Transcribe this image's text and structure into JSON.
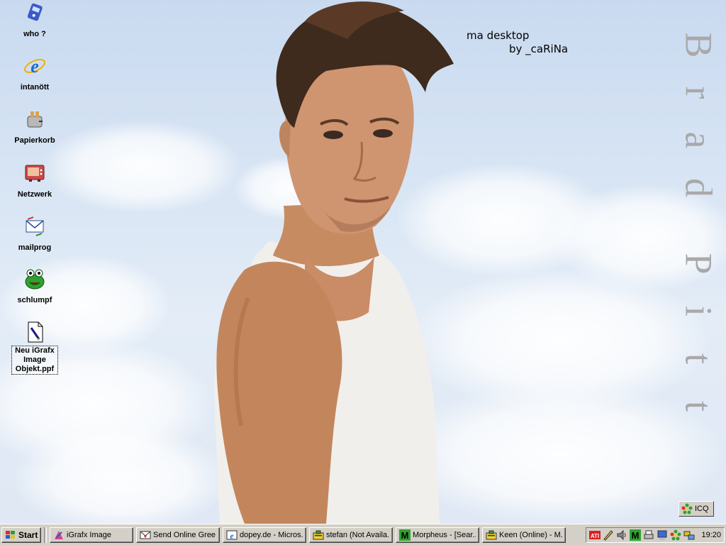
{
  "desktop": {
    "caption_line1": "ma desktop",
    "caption_line2": "by _caRiNa",
    "vertical_name": [
      "B",
      "r",
      "a",
      "d",
      "P",
      "i",
      "t",
      "t"
    ],
    "icons": [
      {
        "label": "who ?",
        "icon": "blue-device-icon"
      },
      {
        "label": "intanött",
        "icon": "internet-explorer-icon"
      },
      {
        "label": "Papierkorb",
        "icon": "toaster-recycle-bin-icon"
      },
      {
        "label": "Netzwerk",
        "icon": "network-tv-icon"
      },
      {
        "label": "mailprog",
        "icon": "mail-program-icon"
      },
      {
        "label": "schlumpf",
        "icon": "kermit-frog-icon"
      },
      {
        "label": "Neu iGrafx Image Objekt.ppf",
        "icon": "document-icon"
      }
    ],
    "icq_label": "ICQ"
  },
  "taskbar": {
    "start_label": "Start",
    "tasks": [
      {
        "label": "iGrafx Image",
        "icon": "igrafx-icon"
      },
      {
        "label": "Send Online Gree...",
        "icon": "email-heart-icon"
      },
      {
        "label": "dopey.de - Micros...",
        "icon": "ie-window-icon"
      },
      {
        "label": "stefan (Not Availa...",
        "icon": "icq-chat-icon"
      },
      {
        "label": "Morpheus - [Sear...",
        "icon": "morpheus-icon"
      },
      {
        "label": "Keen (Online) - M...",
        "icon": "icq-chat-icon"
      }
    ],
    "tray_icons": [
      "ati-icon",
      "pen-icon",
      "speaker-icon",
      "morpheus-tray-icon",
      "printer-icon",
      "computer-icon",
      "icq-flower-icon",
      "network-icon"
    ],
    "clock": "19:20"
  },
  "colors": {
    "sky": "#c9daf0",
    "taskbar": "#d4d0c8",
    "vertical_text": "#a9a9a9"
  }
}
